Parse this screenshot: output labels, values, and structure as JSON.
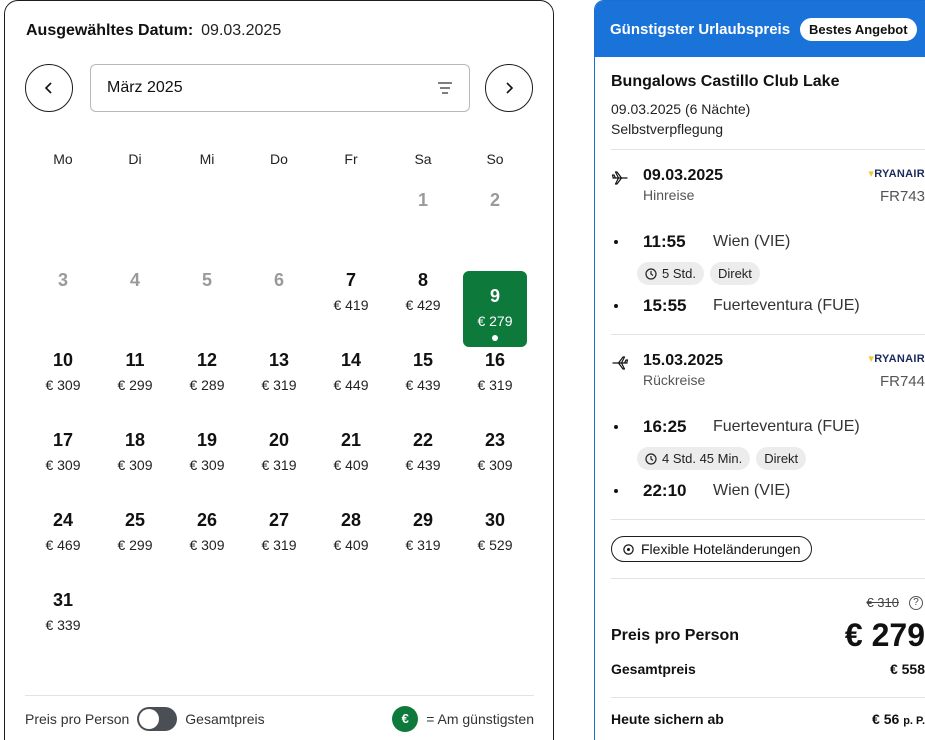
{
  "calendar": {
    "selected_label": "Ausgewähltes Datum:",
    "selected_value": "09.03.2025",
    "month": "März 2025",
    "weekdays": [
      "Mo",
      "Di",
      "Mi",
      "Do",
      "Fr",
      "Sa",
      "So"
    ],
    "leading_blanks": 5,
    "days": [
      {
        "num": "1",
        "price": "",
        "disabled": true
      },
      {
        "num": "2",
        "price": "",
        "disabled": true
      },
      {
        "num": "3",
        "price": "",
        "disabled": true
      },
      {
        "num": "4",
        "price": "",
        "disabled": true
      },
      {
        "num": "5",
        "price": "",
        "disabled": true
      },
      {
        "num": "6",
        "price": "",
        "disabled": true
      },
      {
        "num": "7",
        "price": "€ 419"
      },
      {
        "num": "8",
        "price": "€ 429"
      },
      {
        "num": "9",
        "price": "€ 279",
        "selected": true
      },
      {
        "num": "10",
        "price": "€ 309"
      },
      {
        "num": "11",
        "price": "€ 299"
      },
      {
        "num": "12",
        "price": "€ 289"
      },
      {
        "num": "13",
        "price": "€ 319"
      },
      {
        "num": "14",
        "price": "€ 449"
      },
      {
        "num": "15",
        "price": "€ 439"
      },
      {
        "num": "16",
        "price": "€ 319"
      },
      {
        "num": "17",
        "price": "€ 309"
      },
      {
        "num": "18",
        "price": "€ 309"
      },
      {
        "num": "19",
        "price": "€ 309"
      },
      {
        "num": "20",
        "price": "€ 319"
      },
      {
        "num": "21",
        "price": "€ 409"
      },
      {
        "num": "22",
        "price": "€ 439"
      },
      {
        "num": "23",
        "price": "€ 309"
      },
      {
        "num": "24",
        "price": "€ 469"
      },
      {
        "num": "25",
        "price": "€ 299"
      },
      {
        "num": "26",
        "price": "€ 309"
      },
      {
        "num": "27",
        "price": "€ 319"
      },
      {
        "num": "28",
        "price": "€ 409"
      },
      {
        "num": "29",
        "price": "€ 319"
      },
      {
        "num": "30",
        "price": "€ 529"
      },
      {
        "num": "31",
        "price": "€ 339"
      }
    ],
    "footer": {
      "toggle_left": "Preis pro Person",
      "toggle_right": "Gesamtpreis",
      "legend_symbol": "€",
      "legend_text": "= Am günstigsten"
    }
  },
  "offer": {
    "header_title": "Günstigster Urlaubspreis",
    "badge": "Bestes Angebot",
    "hotel_name": "Bungalows Castillo Club Lake",
    "hotel_dates": "09.03.2025 (6 Nächte)",
    "board": "Selbstverpflegung",
    "outbound": {
      "date": "09.03.2025",
      "direction": "Hinreise",
      "airline": "RYANAIR",
      "flight_no": "FR743",
      "dep_time": "11:55",
      "dep_place": "Wien (VIE)",
      "duration": "5 Std.",
      "stops": "Direkt",
      "arr_time": "15:55",
      "arr_place": "Fuerteventura (FUE)"
    },
    "return": {
      "date": "15.03.2025",
      "direction": "Rückreise",
      "airline": "RYANAIR",
      "flight_no": "FR744",
      "dep_time": "16:25",
      "dep_place": "Fuerteventura (FUE)",
      "duration": "4 Std. 45 Min.",
      "stops": "Direkt",
      "arr_time": "22:10",
      "arr_place": "Wien (VIE)"
    },
    "flex_label": "Flexible Hoteländerungen",
    "old_price": "€ 310",
    "help": "?",
    "pp_label": "Preis pro Person",
    "pp_value": "€ 279",
    "total_label": "Gesamtpreis",
    "total_value": "€ 558",
    "deposit_label": "Heute sichern ab",
    "deposit_value": "€ 56",
    "deposit_suffix": "p. P.",
    "colors": {
      "accent_blue": "#1a73d8",
      "cheap_green": "#0d7a3c"
    }
  }
}
